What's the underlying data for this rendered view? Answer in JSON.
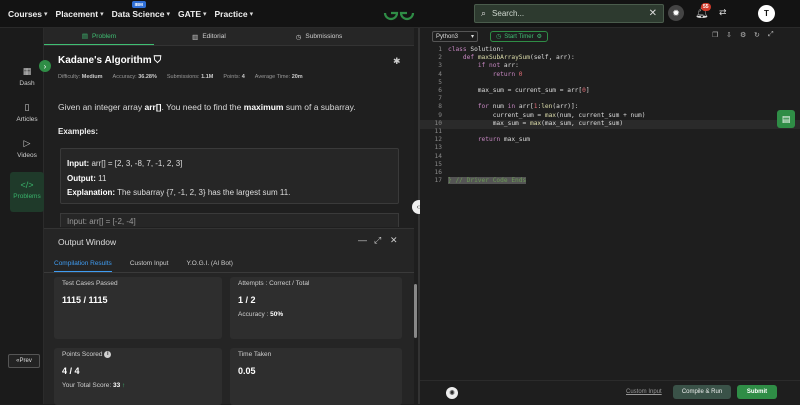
{
  "topnav": {
    "items": [
      {
        "label": "Courses"
      },
      {
        "label": "Placement"
      },
      {
        "label": "Data Science",
        "badge": "IBM"
      },
      {
        "label": "GATE"
      },
      {
        "label": "Practice"
      }
    ],
    "search_placeholder": "Search...",
    "notifications_count": "55",
    "avatar_initial": "T"
  },
  "rail": {
    "items": [
      {
        "label": "Dash",
        "icon": "grid-icon"
      },
      {
        "label": "Articles",
        "icon": "book-icon"
      },
      {
        "label": "Videos",
        "icon": "play-icon"
      },
      {
        "label": "Problems",
        "icon": "code-icon"
      }
    ],
    "prev_label": "Prev"
  },
  "problem": {
    "tabs": [
      "Problem",
      "Editorial",
      "Submissions"
    ],
    "title": "Kadane's Algorithm",
    "meta": {
      "difficulty_label": "Difficulty:",
      "difficulty": "Medium",
      "accuracy_label": "Accuracy:",
      "accuracy": "36.28%",
      "submissions_label": "Submissions:",
      "submissions": "1.1M",
      "points_label": "Points:",
      "points": "4",
      "time_label": "Average Time:",
      "time": "20m"
    },
    "desc_pre": "Given an integer array",
    "desc_arr": "arr[]",
    "desc_mid": ". You need to find the",
    "desc_bold": "maximum",
    "desc_post": "sum of a subarray.",
    "examples_heading": "Examples:",
    "example1": {
      "input_label": "Input:",
      "input": "arr[] = [2, 3, -8, 7, -1, 2, 3]",
      "output_label": "Output:",
      "output": "11",
      "expl_label": "Explanation:",
      "expl": "The subarray {7, -1, 2, 3} has the largest sum 11."
    },
    "example2_partial": "Input: arr[] = [-2, -4]"
  },
  "output": {
    "title": "Output Window",
    "tabs": [
      "Compilation Results",
      "Custom Input",
      "Y.O.G.I. (AI Bot)"
    ],
    "test_cases_label": "Test Cases Passed",
    "test_cases_value": "1115 / 1115",
    "attempts_label": "Attempts : Correct / Total",
    "attempts_value": "1 / 2",
    "accuracy_label": "Accuracy :",
    "accuracy_value": "50%",
    "points_label": "Points Scored",
    "points_value": "4 / 4",
    "total_score_label": "Your Total Score:",
    "total_score_value": "33",
    "time_label": "Time Taken",
    "time_value": "0.05"
  },
  "editor": {
    "language": "Python3",
    "timer_label": "Start Timer",
    "custom_input": "Custom Input",
    "run_label": "Compile & Run",
    "submit_label": "Submit",
    "lines": [
      {
        "n": "1",
        "code": "class Solution:"
      },
      {
        "n": "2",
        "code": "    def maxSubArraySum(self, arr):"
      },
      {
        "n": "3",
        "code": "        if not arr:"
      },
      {
        "n": "4",
        "code": "            return 0"
      },
      {
        "n": "5",
        "code": ""
      },
      {
        "n": "6",
        "code": "        max_sum = current_sum = arr[0]"
      },
      {
        "n": "7",
        "code": ""
      },
      {
        "n": "8",
        "code": "        for num in arr[1:len(arr)]:"
      },
      {
        "n": "9",
        "code": "            current_sum = max(num, current_sum + num)"
      },
      {
        "n": "10",
        "code": "            max_sum = max(max_sum, current_sum)"
      },
      {
        "n": "11",
        "code": ""
      },
      {
        "n": "12",
        "code": "        return max_sum"
      },
      {
        "n": "13",
        "code": ""
      },
      {
        "n": "14",
        "code": ""
      },
      {
        "n": "15",
        "code": ""
      },
      {
        "n": "16",
        "code": ""
      },
      {
        "n": "17",
        "code": "} // Driver Code Ends"
      }
    ]
  },
  "colors": {
    "accent": "#2f8d46",
    "tab_active": "#3f9cf1"
  }
}
